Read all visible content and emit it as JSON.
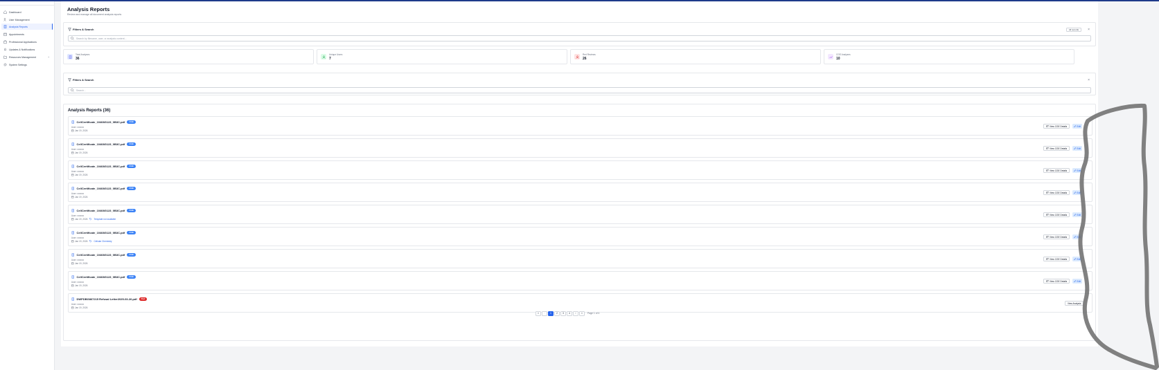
{
  "sidebar": {
    "items": [
      {
        "label": "Dashboard",
        "icon": "home-icon",
        "active": false
      },
      {
        "label": "User Management",
        "icon": "users-icon",
        "active": false
      },
      {
        "label": "Analysis Reports",
        "icon": "file-text-icon",
        "active": true
      },
      {
        "label": "Appointments",
        "icon": "calendar-icon",
        "active": false
      },
      {
        "label": "Professional Applications",
        "icon": "briefcase-icon",
        "active": false
      },
      {
        "label": "Updates & Notifications",
        "icon": "bell-icon",
        "active": false
      },
      {
        "label": "Resources Management",
        "icon": "folder-icon",
        "active": false
      },
      {
        "label": "System Settings",
        "icon": "gear-icon",
        "active": false
      }
    ]
  },
  "page": {
    "title": "Analysis Reports",
    "subtitle": "Review and manage all document analysis reports"
  },
  "filters_top": {
    "title": "Filters & Search",
    "all_button": "All records",
    "search_placeholder": "Search by filename, user, or analysis content...",
    "close": "×"
  },
  "stats": [
    {
      "label": "Total Analyses",
      "value": "36",
      "color": "#6366f1",
      "bg": "#e0e7ff"
    },
    {
      "label": "Unique Users",
      "value": "7",
      "color": "#16a34a",
      "bg": "#dcfce7"
    },
    {
      "label": "Red Reviews",
      "value": "26",
      "color": "#dc2626",
      "bg": "#fee2e2"
    },
    {
      "label": "CGE Analyses",
      "value": "10",
      "color": "#9333ea",
      "bg": "#f3e8ff"
    }
  ],
  "filters_second": {
    "title": "Filters & Search",
    "search_placeholder": "Search...",
    "close": "×"
  },
  "reports": {
    "title": "Analysis Reports (36)",
    "view_label": "View CGE Details",
    "edit_label": "Edit",
    "view_analysis_label": "View Analysis",
    "items": [
      {
        "filename": "CellCertificate_10408G123_0B3C.pdf",
        "badge": "CGE",
        "user": "User: xxxxxx",
        "date": "Jan 19, 2026",
        "extra": "",
        "kind": "cge"
      },
      {
        "filename": "CellCertificate_10408G123_0B3C.pdf",
        "badge": "CGE",
        "user": "User: xxxxxx",
        "date": "Jan 19, 2026",
        "extra": "",
        "kind": "cge"
      },
      {
        "filename": "CellCertificate_10408G123_0B3C.pdf",
        "badge": "CGE",
        "user": "User: xxxxxx",
        "date": "Jan 19, 2026",
        "extra": "",
        "kind": "cge"
      },
      {
        "filename": "CellCertificate_10408G123_0B3C.pdf",
        "badge": "CGE",
        "user": "User: xxxxxx",
        "date": "Jan 19, 2026",
        "extra": "",
        "kind": "cge"
      },
      {
        "filename": "CellCertificate_10408G123_0B3C.pdf",
        "badge": "CGE",
        "user": "User: xxxxxx",
        "date": "Jan 19, 2026",
        "extra": "Template not available",
        "kind": "cge"
      },
      {
        "filename": "CellCertificate_10408G123_0B3C.pdf",
        "badge": "CGE",
        "user": "User: xxxxxx",
        "date": "Jan 19, 2026",
        "extra": "Cellular Chemistry",
        "kind": "cge"
      },
      {
        "filename": "CellCertificate_10408G123_0B3C.pdf",
        "badge": "CGE",
        "user": "User: xxxxxx",
        "date": "Jan 19, 2026",
        "extra": "",
        "kind": "cge"
      },
      {
        "filename": "CellCertificate_10408G123_0B3C.pdf",
        "badge": "CGE",
        "user": "User: xxxxxx",
        "date": "Jan 19, 2026",
        "extra": "",
        "kind": "cge"
      },
      {
        "filename": "DWPDBG867215 Refusal Letter2025-03-26.pdf",
        "badge": "Red",
        "user": "User: xxxxxx",
        "date": "Jan 19, 2026",
        "extra": "",
        "kind": "red"
      }
    ]
  },
  "pagination": {
    "first": "«",
    "prev": "‹",
    "pages": [
      "1",
      "2",
      "3",
      "4"
    ],
    "current": "1",
    "next": "›",
    "last": "»",
    "info": "Page 1 of 4"
  }
}
